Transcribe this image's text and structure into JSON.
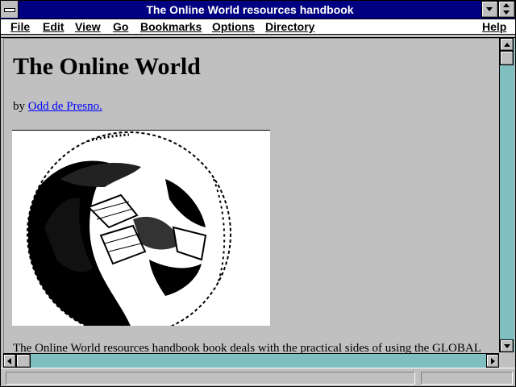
{
  "window": {
    "title": "The Online World resources handbook"
  },
  "menu": {
    "file": "File",
    "edit": "Edit",
    "view": "View",
    "go": "Go",
    "bookmarks": "Bookmarks",
    "options": "Options",
    "directory": "Directory",
    "help": "Help"
  },
  "document": {
    "heading": "The Online World",
    "by_prefix": "by ",
    "author_link": "Odd de Presno.",
    "figure_icon": "globe-image",
    "body_first_line": "The Online World resources handbook book deals with the practical sides of using the GLOBAL"
  },
  "status": {
    "text": "",
    "progress": 0
  },
  "colors": {
    "titlebar": "#000080",
    "link": "#0000ff",
    "scroll_track": "#7fbfbf",
    "chrome": "#c0c0c0"
  }
}
